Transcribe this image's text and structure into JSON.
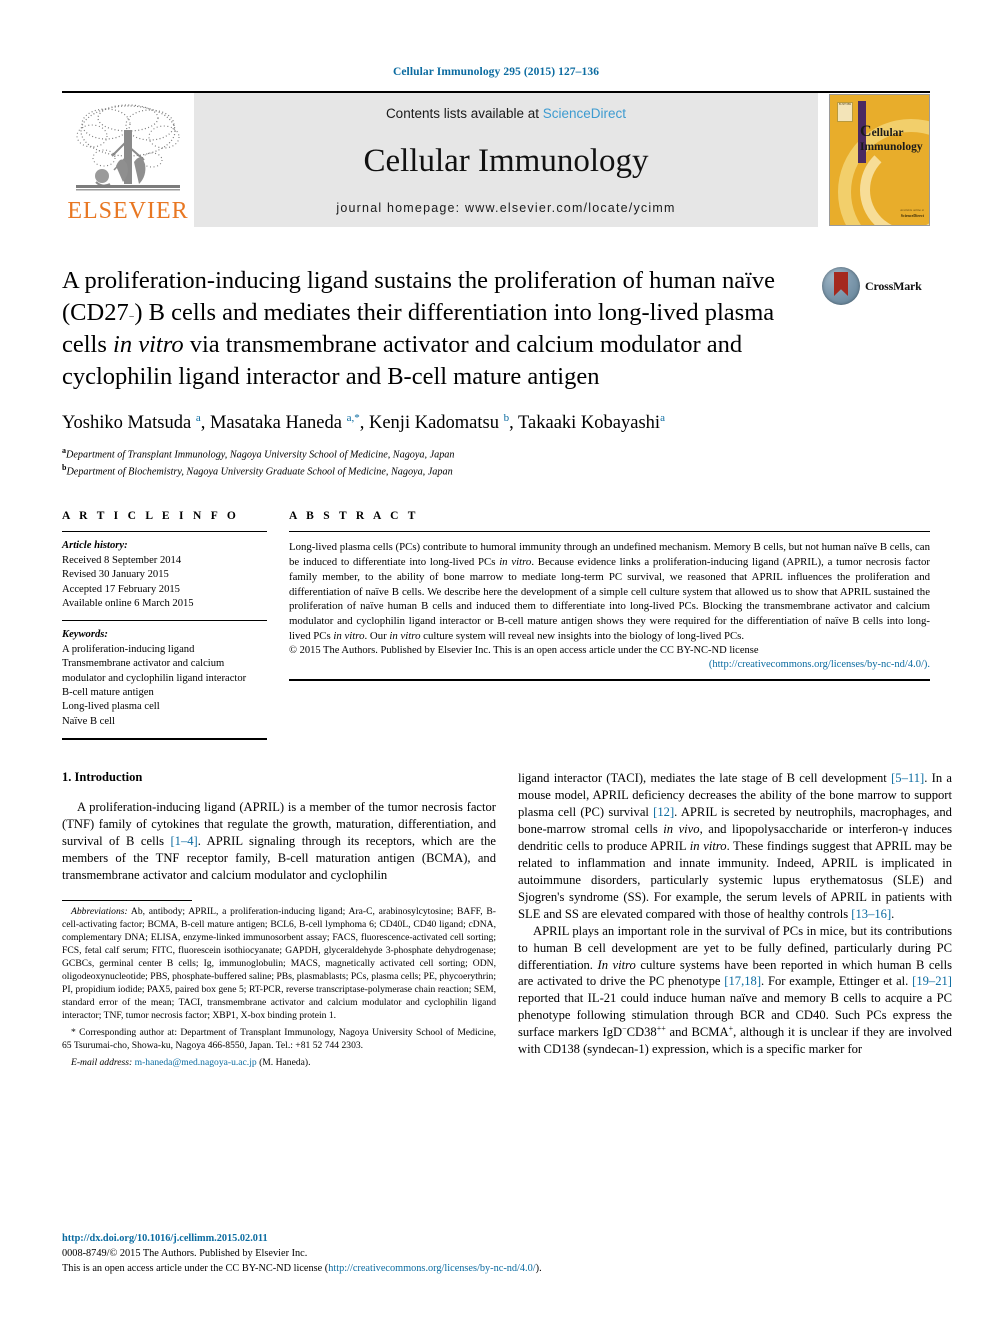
{
  "running_head": "Cellular Immunology 295 (2015) 127–136",
  "masthead": {
    "contents_prefix": "Contents lists available at ",
    "sciencedirect": "ScienceDirect",
    "journal_title": "Cellular Immunology",
    "homepage": "journal homepage: www.elsevier.com/locate/ycimm",
    "publisher_wordmark": "ELSEVIER",
    "cover": {
      "title_line1": "ellular",
      "title_line2": "Immunology",
      "initial": "C",
      "elsevier_box": "ELSEVIER",
      "footnote_small": "Available online at",
      "footnote_bold": "ScienceDirect"
    }
  },
  "article": {
    "title_html": "A proliferation-inducing ligand sustains the proliferation of human naïve (CD27<span class=\"minus\">−</span>) B cells and mediates their differentiation into long-lived plasma cells <i>in vitro</i> via transmembrane activator and calcium modulator and cyclophilin ligand interactor and B-cell mature antigen",
    "title_plain": "A proliferation-inducing ligand sustains the proliferation of human naïve (CD27−) B cells and mediates their differentiation into long-lived plasma cells in vitro via transmembrane activator and calcium modulator and cyclophilin ligand interactor and B-cell mature antigen",
    "authors_html": "Yoshiko Matsuda <sup>a</sup>, Masataka Haneda <sup>a,*</sup>, Kenji Kadomatsu <sup>b</sup>, Takaaki Kobayashi<sup>a</sup>",
    "affiliations_html": "<sup>a</sup>Department of Transplant Immunology, Nagoya University School of Medicine, Nagoya, Japan<br><sup>b</sup>Department of Biochemistry, Nagoya University Graduate School of Medicine, Nagoya, Japan",
    "crossmark_label": "CrossMark"
  },
  "article_info": {
    "heading": "A R T I C L E   I N F O",
    "history_label": "Article history:",
    "history": [
      "Received 8 September 2014",
      "Revised 30 January 2015",
      "Accepted 17 February 2015",
      "Available online 6 March 2015"
    ],
    "keywords_label": "Keywords:",
    "keywords": [
      "A proliferation-inducing ligand",
      "Transmembrane activator and calcium modulator and cyclophilin ligand interactor",
      "B-cell mature antigen",
      "Long-lived plasma cell",
      "Naïve B cell"
    ]
  },
  "abstract": {
    "heading": "A B S T R A C T",
    "body_html": "Long-lived plasma cells (PCs) contribute to humoral immunity through an undefined mechanism. Memory B cells, but not human naïve B cells, can be induced to differentiate into long-lived PCs <i>in vitro</i>. Because evidence links a proliferation-inducing ligand (APRIL), a tumor necrosis factor family member, to the ability of bone marrow to mediate long-term PC survival, we reasoned that APRIL influences the proliferation and differentiation of naïve B cells. We describe here the development of a simple cell culture system that allowed us to show that APRIL sustained the proliferation of naïve human B cells and induced them to differentiate into long-lived PCs. Blocking the transmembrane activator and calcium modulator and cyclophilin ligand interactor or B-cell mature antigen shows they were required for the differentiation of naïve B cells into long-lived PCs <i>in vitro</i>. Our <i>in vitro</i> culture system will reveal new insights into the biology of long-lived PCs.",
    "copyright": "© 2015 The Authors. Published by Elsevier Inc. This is an open access article under the CC BY-NC-ND license",
    "license_url": "(http://creativecommons.org/licenses/by-nc-nd/4.0/)."
  },
  "intro": {
    "heading": "1. Introduction",
    "left_paragraph_html": "A proliferation-inducing ligand (APRIL) is a member of the tumor necrosis factor (TNF) family of cytokines that regulate the growth, maturation, differentiation, and survival of B cells <span class=\"ref\">[1–4]</span>. APRIL signaling through its receptors, which are the members of the TNF receptor family, B-cell maturation antigen (BCMA), and transmembrane activator and calcium modulator and cyclophilin",
    "right_paragraph_1_html": "ligand interactor (TACI), mediates the late stage of B cell development <span class=\"ref\">[5–11]</span>. In a mouse model, APRIL deficiency decreases the ability of the bone marrow to support plasma cell (PC) survival <span class=\"ref\">[12]</span>. APRIL is secreted by neutrophils, macrophages, and bone-marrow stromal cells <i>in vivo</i>, and lipopolysaccharide or interferon-γ induces dendritic cells to produce APRIL <i>in vitro</i>. These findings suggest that APRIL may be related to inflammation and innate immunity. Indeed, APRIL is implicated in autoimmune disorders, particularly systemic lupus erythematosus (SLE) and Sjogren's syndrome (SS). For example, the serum levels of APRIL in patients with SLE and SS are elevated compared with those of healthy controls <span class=\"ref\">[13–16]</span>.",
    "right_paragraph_2_html": "APRIL plays an important role in the survival of PCs in mice, but its contributions to human B cell development are yet to be fully defined, particularly during PC differentiation. <i>In vitro</i> culture systems have been reported in which human B cells are activated to drive the PC phenotype <span class=\"ref\">[17,18]</span>. For example, Ettinger et al. <span class=\"ref\">[19–21]</span> reported that IL-21 could induce human naïve and memory B cells to acquire a PC phenotype following stimulation through BCR and CD40. Such PCs express the surface markers IgD<sup class=\"tiny\">−</sup>CD38<sup class=\"tiny\">++</sup> and BCMA<sup class=\"tiny\">+</sup>, although it is unclear if they are involved with CD138 (syndecan-1) expression, which is a specific marker for"
  },
  "footnotes": {
    "abbreviations_html": "<span class=\"it\">Abbreviations:</span> Ab, antibody; APRIL, a proliferation-inducing ligand; Ara-C, arabinosylcytosine; BAFF, B-cell-activating factor; BCMA, B-cell mature antigen; BCL6, B-cell lymphoma 6; CD40L, CD40 ligand; cDNA, complementary DNA; ELISA, enzyme-linked immunosorbent assay; FACS, fluorescence-activated cell sorting; FCS, fetal calf serum; FITC, fluorescein isothiocyanate; GAPDH, glyceraldehyde 3-phosphate dehydrogenase; GCBCs, germinal center B cells; Ig, immunoglobulin; MACS, magnetically activated cell sorting; ODN, oligodeoxynucleotide; PBS, phosphate-buffered saline; PBs, plasmablasts; PCs, plasma cells; PE, phycoerythrin; PI, propidium iodide; PAX5, paired box gene 5; RT-PCR, reverse transcriptase-polymerase chain reaction; SEM, standard error of the mean; TACI, transmembrane activator and calcium modulator and cyclophilin ligand interactor; TNF, tumor necrosis factor; XBP1, X-box binding protein 1.",
    "corresponding_html": "* Corresponding author at: Department of Transplant Immunology, Nagoya University School of Medicine, 65 Tsurumai-cho, Showa-ku, Nagoya 466-8550, Japan. Tel.: +81 52 744 2303.",
    "email_label": "E-mail address:",
    "email": "m-haneda@med.nagoya-u.ac.jp",
    "email_suffix": "(M. Haneda)."
  },
  "publisher_footer": {
    "doi": "http://dx.doi.org/10.1016/j.cellimm.2015.02.011",
    "issn_line": "0008-8749/© 2015 The Authors. Published by Elsevier Inc.",
    "license_prefix": "This is an open access article under the CC BY-NC-ND license (",
    "license_url": "http://creativecommons.org/licenses/by-nc-nd/4.0/",
    "license_suffix": ")."
  },
  "colors": {
    "link_blue": "#0b6ba0",
    "sciencedirect_blue": "#3d9bd0",
    "elsevier_orange": "#E87722",
    "cover_gold": "#e8ad2b",
    "masthead_grey": "#e6e6e6"
  }
}
